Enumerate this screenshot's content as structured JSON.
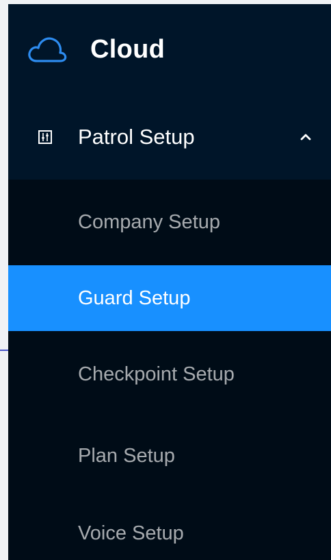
{
  "app": {
    "name": "Cloud",
    "logo_icon": "cloud-icon"
  },
  "colors": {
    "sidebar_bg": "#001529",
    "submenu_bg": "#000c17",
    "accent": "#1890ff",
    "text_primary": "#ffffff",
    "text_muted": "rgba(255,255,255,0.65)"
  },
  "menu": {
    "submenu": {
      "label": "Patrol Setup",
      "icon": "sliders-icon",
      "expanded": true,
      "arrow_icon": "chevron-up-icon"
    },
    "items": [
      {
        "label": "Company Setup",
        "selected": false
      },
      {
        "label": "Guard Setup",
        "selected": true
      },
      {
        "label": "Checkpoint Setup",
        "selected": false
      },
      {
        "label": "Plan Setup",
        "selected": false
      },
      {
        "label": "Voice Setup",
        "selected": false
      }
    ]
  }
}
